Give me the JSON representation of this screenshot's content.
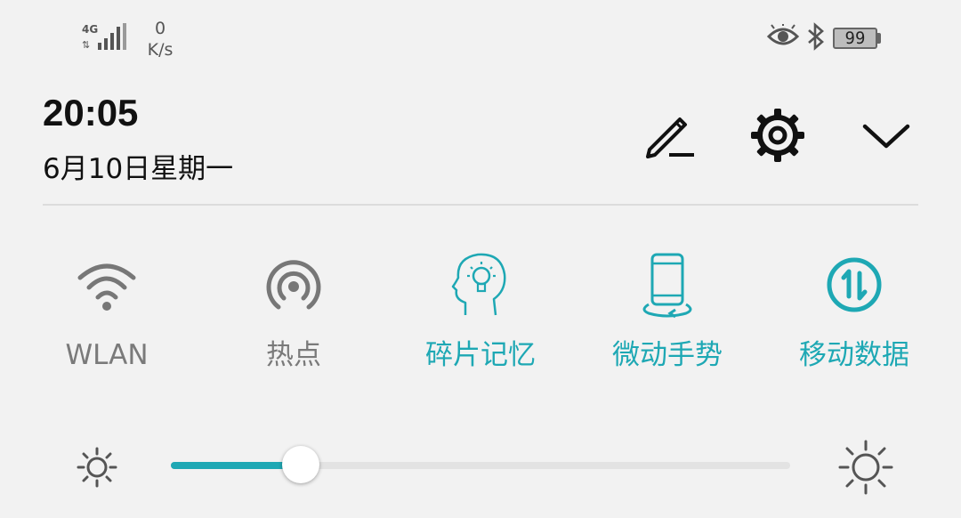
{
  "status_bar": {
    "network_type": "4G",
    "speed_value": "0",
    "speed_unit": "K/s",
    "battery_level": "99",
    "icons": [
      "signal-icon",
      "eye-icon",
      "bluetooth-icon",
      "battery-icon"
    ]
  },
  "header": {
    "time": "20:05",
    "date": "6月10日星期一",
    "buttons": [
      "edit-icon",
      "gear-icon",
      "chevron-down-icon"
    ]
  },
  "tiles": [
    {
      "label": "WLAN",
      "state": "off",
      "icon": "wifi-icon"
    },
    {
      "label": "热点",
      "state": "off",
      "icon": "hotspot-icon"
    },
    {
      "label": "碎片记忆",
      "state": "on",
      "icon": "brain-bulb-icon"
    },
    {
      "label": "微动手势",
      "state": "on",
      "icon": "phone-gesture-icon"
    },
    {
      "label": "移动数据",
      "state": "on",
      "icon": "mobile-data-icon"
    }
  ],
  "brightness": {
    "level": 0.21,
    "colors": {
      "accent": "#1ea8b4",
      "track": "#e3e3e3"
    }
  },
  "colors": {
    "accent": "#1ea8b4",
    "inactive": "#7a7a7a",
    "background": "#f2f2f2"
  }
}
